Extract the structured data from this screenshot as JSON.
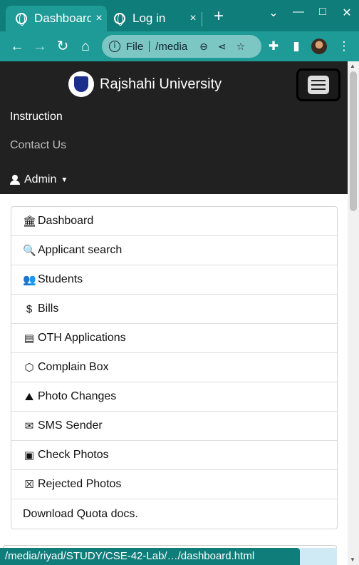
{
  "browser": {
    "tabs": [
      {
        "title": "Dashboard",
        "close": "×"
      },
      {
        "title": "Log in",
        "close": "×"
      }
    ],
    "new_tab": "+",
    "window_controls": {
      "chevron": "⌄",
      "minimize": "—",
      "maximize": "□",
      "close": "✕"
    },
    "omnibox": {
      "scheme_label": "File",
      "url": "/media"
    },
    "status_url": "/media/riyad/STUDY/CSE-42-Lab/…/dashboard.html"
  },
  "navbar": {
    "brand": "Rajshahi University",
    "links": [
      "Instruction",
      "Contact Us"
    ],
    "admin_label": "Admin"
  },
  "menu": {
    "items": [
      {
        "label": "Dashboard",
        "icon": "bank-icon",
        "glyph": "🏛"
      },
      {
        "label": "Applicant search",
        "icon": "search-icon",
        "glyph": "🔍"
      },
      {
        "label": "Students",
        "icon": "people-icon",
        "glyph": "👥"
      },
      {
        "label": "Bills",
        "icon": "dollar-icon",
        "glyph": "$"
      },
      {
        "label": "OTH Applications",
        "icon": "list-card-icon",
        "glyph": "▤"
      },
      {
        "label": "Complain Box",
        "icon": "box-icon",
        "glyph": "⬡"
      },
      {
        "label": "Photo Changes",
        "icon": "person-image-icon",
        "glyph": "⛰"
      },
      {
        "label": "SMS Sender",
        "icon": "envelope-icon",
        "glyph": "✉"
      },
      {
        "label": "Check Photos",
        "icon": "image-icon",
        "glyph": "▣"
      },
      {
        "label": "Rejected Photos",
        "icon": "file-x-icon",
        "glyph": "☒"
      },
      {
        "label": "Download Quota docs.",
        "icon": "",
        "glyph": ""
      }
    ]
  },
  "colors": {
    "chrome": "#0f7d7a",
    "chrome_light": "#1e9a97",
    "navbar": "#212121"
  }
}
